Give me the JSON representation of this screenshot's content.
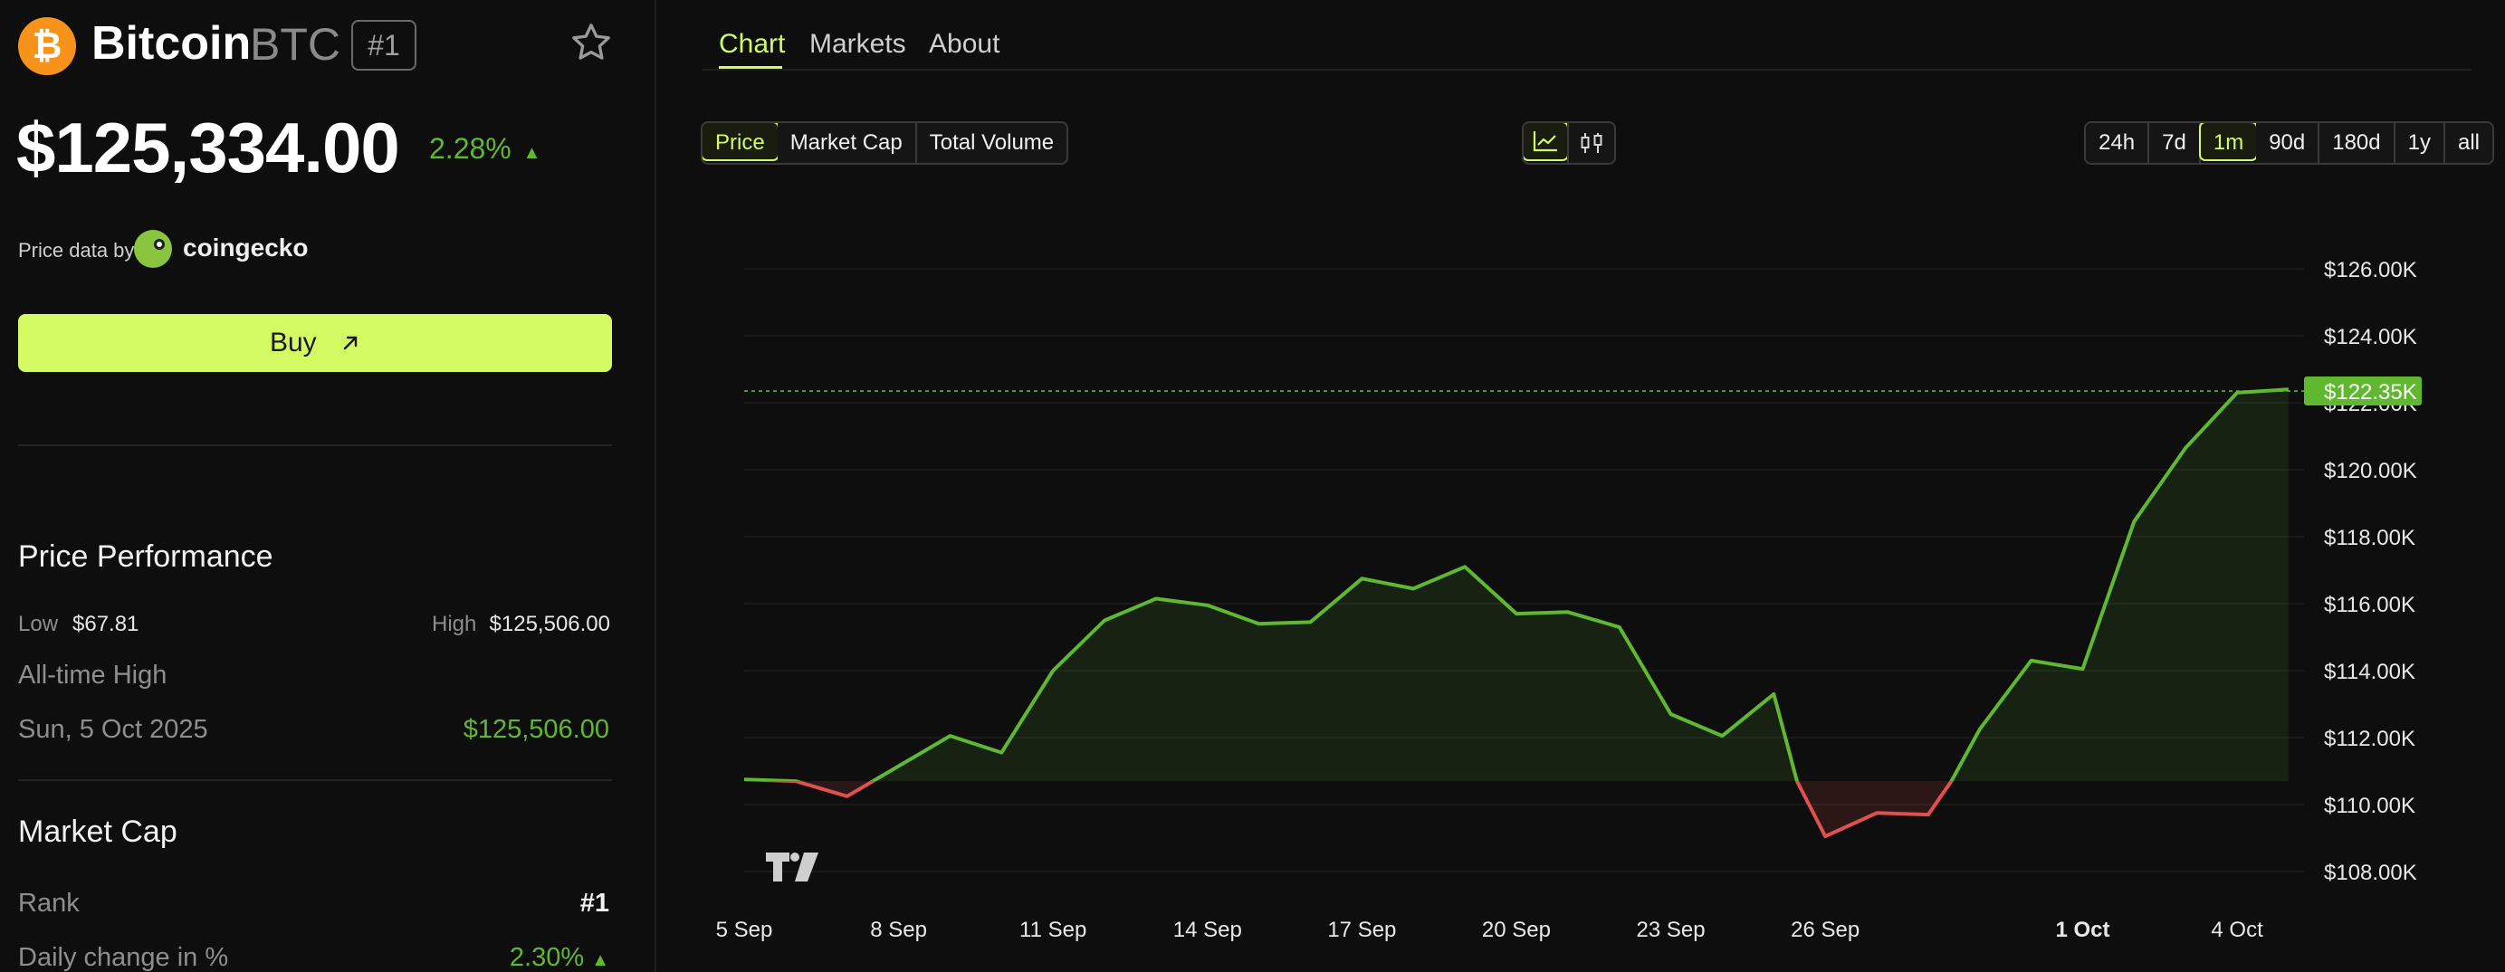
{
  "coin": {
    "logo_glyph": "₿",
    "name": "Bitcoin",
    "symbol": "BTC",
    "rank": "#1",
    "price": "$125,334.00",
    "change": "2.28%",
    "change_arrow": "▲"
  },
  "price_source": {
    "label": "Price data by",
    "provider": "coingecko"
  },
  "buy_button": {
    "label": "Buy",
    "icon": "arrow-up-right-icon"
  },
  "performance": {
    "title": "Price Performance",
    "low_label": "Low",
    "low_value": "$67.81",
    "high_label": "High",
    "high_value": "$125,506.00",
    "ath_label": "All-time High",
    "ath_date": "Sun, 5 Oct 2025",
    "ath_value": "$125,506.00"
  },
  "market_cap": {
    "title": "Market Cap",
    "rank_label": "Rank",
    "rank_value": "#1",
    "daily_change_label": "Daily change in %",
    "daily_change_value": "2.30%",
    "daily_change_arrow": "▲"
  },
  "tabs": [
    {
      "label": "Chart",
      "active": true
    },
    {
      "label": "Markets",
      "active": false
    },
    {
      "label": "About",
      "active": false
    }
  ],
  "metric_buttons": [
    {
      "label": "Price",
      "active": true
    },
    {
      "label": "Market Cap",
      "active": false
    },
    {
      "label": "Total Volume",
      "active": false
    }
  ],
  "chart_style_buttons": [
    {
      "icon": "line-chart-icon",
      "active": true
    },
    {
      "icon": "candlestick-icon",
      "active": false
    }
  ],
  "range_buttons": [
    {
      "label": "24h",
      "active": false
    },
    {
      "label": "7d",
      "active": false
    },
    {
      "label": "1m",
      "active": true
    },
    {
      "label": "90d",
      "active": false
    },
    {
      "label": "180d",
      "active": false
    },
    {
      "label": "1y",
      "active": false
    },
    {
      "label": "all",
      "active": false
    }
  ],
  "colors": {
    "accent": "#d3fa62",
    "up": "#5fb830",
    "down": "#e0504f",
    "bitcoin": "#f7931a"
  },
  "chart_data": {
    "type": "area",
    "baseline": 110700,
    "ylim": [
      107000,
      127000
    ],
    "y_ticks": [
      108000,
      110000,
      112000,
      114000,
      116000,
      118000,
      120000,
      122000,
      124000,
      126000
    ],
    "y_tick_labels": [
      "$108.00K",
      "$110.00K",
      "$112.00K",
      "$114.00K",
      "$116.00K",
      "$118.00K",
      "$120.00K",
      "$122.00K",
      "$124.00K",
      "$126.00K"
    ],
    "current_price_label": "$122.35K",
    "current_price": 122350,
    "xlim": [
      5.0,
      35.3
    ],
    "x_ticks": [
      5,
      8,
      11,
      14,
      17,
      20,
      23,
      26,
      31,
      34
    ],
    "x_tick_labels": [
      "5 Sep",
      "8 Sep",
      "11 Sep",
      "14 Sep",
      "17 Sep",
      "20 Sep",
      "23 Sep",
      "26 Sep",
      "1 Oct",
      "4 Oct"
    ],
    "x_tick_bold": [
      false,
      false,
      false,
      false,
      false,
      false,
      false,
      false,
      true,
      false
    ],
    "x": [
      5.0,
      6.0,
      7.0,
      8.0,
      9.0,
      10.0,
      11.0,
      12.0,
      13.0,
      14.0,
      15.0,
      16.0,
      17.0,
      18.0,
      19.0,
      20.0,
      21.0,
      22.0,
      23.0,
      24.0,
      25.0,
      25.45,
      26.0,
      27.0,
      28.0,
      28.45,
      29.0,
      30.0,
      31.0,
      32.0,
      33.0,
      34.0,
      35.0
    ],
    "y": [
      110750,
      110700,
      110250,
      111150,
      112050,
      111550,
      114000,
      115500,
      116150,
      115950,
      115400,
      115450,
      116750,
      116450,
      117100,
      115700,
      115750,
      115300,
      112700,
      112050,
      113300,
      110700,
      109050,
      109750,
      109700,
      110700,
      112250,
      114300,
      114050,
      118450,
      120650,
      122300,
      122400
    ]
  }
}
